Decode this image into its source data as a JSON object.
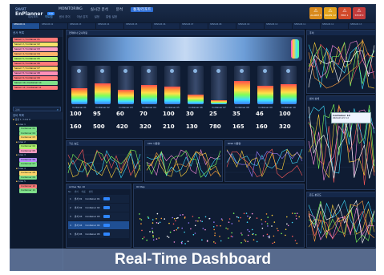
{
  "app": {
    "logo_top": "SMART",
    "logo_name": "EnPlanner",
    "version": "3.0"
  },
  "menu": [
    "MONITORING",
    "실시간 분석",
    "분석",
    "통계/리포트"
  ],
  "submenu": [
    "대시보드",
    "히트맵",
    "센서 추이",
    "이상 감지",
    "설정",
    "알림 설정"
  ],
  "alarms": [
    {
      "label": "ALARM",
      "count": "3",
      "color": "#d98a1d"
    },
    {
      "label": "WARN",
      "count": "12",
      "color": "#e2a21d"
    },
    {
      "label": "ERR",
      "count": "1",
      "color": "#d24a2a"
    },
    {
      "label": "STOP",
      "count": "0",
      "color": "#c23b3b"
    }
  ],
  "tabs": [
    "SENSOR 01",
    "SENSOR 02",
    "SENSOR 03",
    "SENSOR 04",
    "SENSOR 05",
    "SENSOR 06",
    "SENSOR 07",
    "SENSOR 08",
    "SENSOR 09",
    "SENSOR 10",
    "SENSOR 11",
    "SENSOR 12",
    "SENSOR 13"
  ],
  "sidebar": {
    "sensor_header": "센서 목록",
    "sensors": [
      {
        "label": "Sensor 1 / Container 01",
        "color": "#ff7a7a"
      },
      {
        "label": "Sensor 2 / Container 02",
        "color": "#f5e26a"
      },
      {
        "label": "Sensor 3 / Container 03",
        "color": "#ff9cc2"
      },
      {
        "label": "Sensor 4 / Container 04",
        "color": "#ffb36b"
      },
      {
        "label": "Sensor 5 / Container 05",
        "color": "#b2f16f"
      },
      {
        "label": "Sensor 6 / Container 06",
        "color": "#ff7a7a"
      },
      {
        "label": "Sensor 7 / Container 07",
        "color": "#ffd36a"
      },
      {
        "label": "Sensor 8 / Container 08",
        "color": "#ff8fb6"
      },
      {
        "label": "Sensor 9 / Container 09",
        "color": "#ff7a7a"
      },
      {
        "label": "Sensor 10 / Container 10",
        "color": "#7fe08a"
      },
      {
        "label": "Sensor 11 / Container 11",
        "color": "#ff7a7a"
      }
    ],
    "search_label": "검색",
    "tree_header": "장비 목록",
    "tree": [
      {
        "text": "공장 1 / Line A",
        "tag": "",
        "color": ""
      },
      {
        "text": "Area 1",
        "tag": "",
        "color": ""
      },
      {
        "text": "",
        "tag": "Container 01",
        "color": "#7fe08a"
      },
      {
        "text": "",
        "tag": "Container 02",
        "color": "#7fe08a"
      },
      {
        "text": "",
        "tag": "Container 03",
        "color": "#ffd36a"
      },
      {
        "text": "Area 2",
        "tag": "",
        "color": ""
      },
      {
        "text": "",
        "tag": "Container 04",
        "color": "#b2f16f"
      },
      {
        "text": "",
        "tag": "Container 05",
        "color": "#ff9cc2"
      },
      {
        "text": "Area 3",
        "tag": "",
        "color": ""
      },
      {
        "text": "",
        "tag": "Container 06",
        "color": "#b98cff"
      },
      {
        "text": "",
        "tag": "Container 07",
        "color": "#7fe08a"
      },
      {
        "text": "Area 4",
        "tag": "",
        "color": ""
      },
      {
        "text": "",
        "tag": "Container 08",
        "color": "#ffd36a"
      },
      {
        "text": "",
        "tag": "Container 09",
        "color": "#7fe08a"
      },
      {
        "text": "Area 5",
        "tag": "",
        "color": ""
      },
      {
        "text": "",
        "tag": "Container 10",
        "color": "#ff7a7a"
      },
      {
        "text": "",
        "tag": "Container 11",
        "color": "#7fe08a"
      }
    ]
  },
  "containers": {
    "title": "컨테이너 모니터링",
    "items": [
      {
        "name": "Container 01",
        "v1": "100",
        "v2": "160",
        "level": 0.42
      },
      {
        "name": "Container 02",
        "v1": "95",
        "v2": "500",
        "level": 0.55
      },
      {
        "name": "Container 03",
        "v1": "60",
        "v2": "420",
        "level": 0.38
      },
      {
        "name": "Container 04",
        "v1": "70",
        "v2": "320",
        "level": 0.5
      },
      {
        "name": "Container 05",
        "v1": "100",
        "v2": "210",
        "level": 0.45
      },
      {
        "name": "Container 06",
        "v1": "30",
        "v2": "130",
        "level": 0.25
      },
      {
        "name": "Container 07",
        "v1": "25",
        "v2": "780",
        "level": 0.1
      },
      {
        "name": "Container 08",
        "v1": "35",
        "v2": "165",
        "level": 0.6
      },
      {
        "name": "Container 09",
        "v1": "46",
        "v2": "160",
        "level": 0.48
      },
      {
        "name": "Container 10",
        "v1": "100",
        "v2": "320",
        "level": 0.52
      }
    ]
  },
  "panels": {
    "right_top": "추이",
    "right_mid": "센서 상세",
    "right_bottom": "온도 분포도",
    "tooltip_title": "Container 10",
    "tooltip_value": "2024-03-15  3.2",
    "chart_a": "가스 농도",
    "chart_b": "CPU 사용량",
    "chart_c": "DISK 사용량",
    "list_title": "Active Top 10",
    "scatter_title": "IO Map",
    "list_head": [
      "No",
      "센서",
      "이름",
      "상태"
    ],
    "list_rows": [
      {
        "no": "1",
        "s": "센서 01",
        "n": "Container 01"
      },
      {
        "no": "2",
        "s": "센서 02",
        "n": "Container 02"
      },
      {
        "no": "3",
        "s": "센서 03",
        "n": "Container 03"
      },
      {
        "no": "4",
        "s": "센서 04",
        "n": "Container 04"
      },
      {
        "no": "5",
        "s": "센서 05",
        "n": "Container 05"
      }
    ]
  },
  "caption": "Real-Time Dashboard"
}
